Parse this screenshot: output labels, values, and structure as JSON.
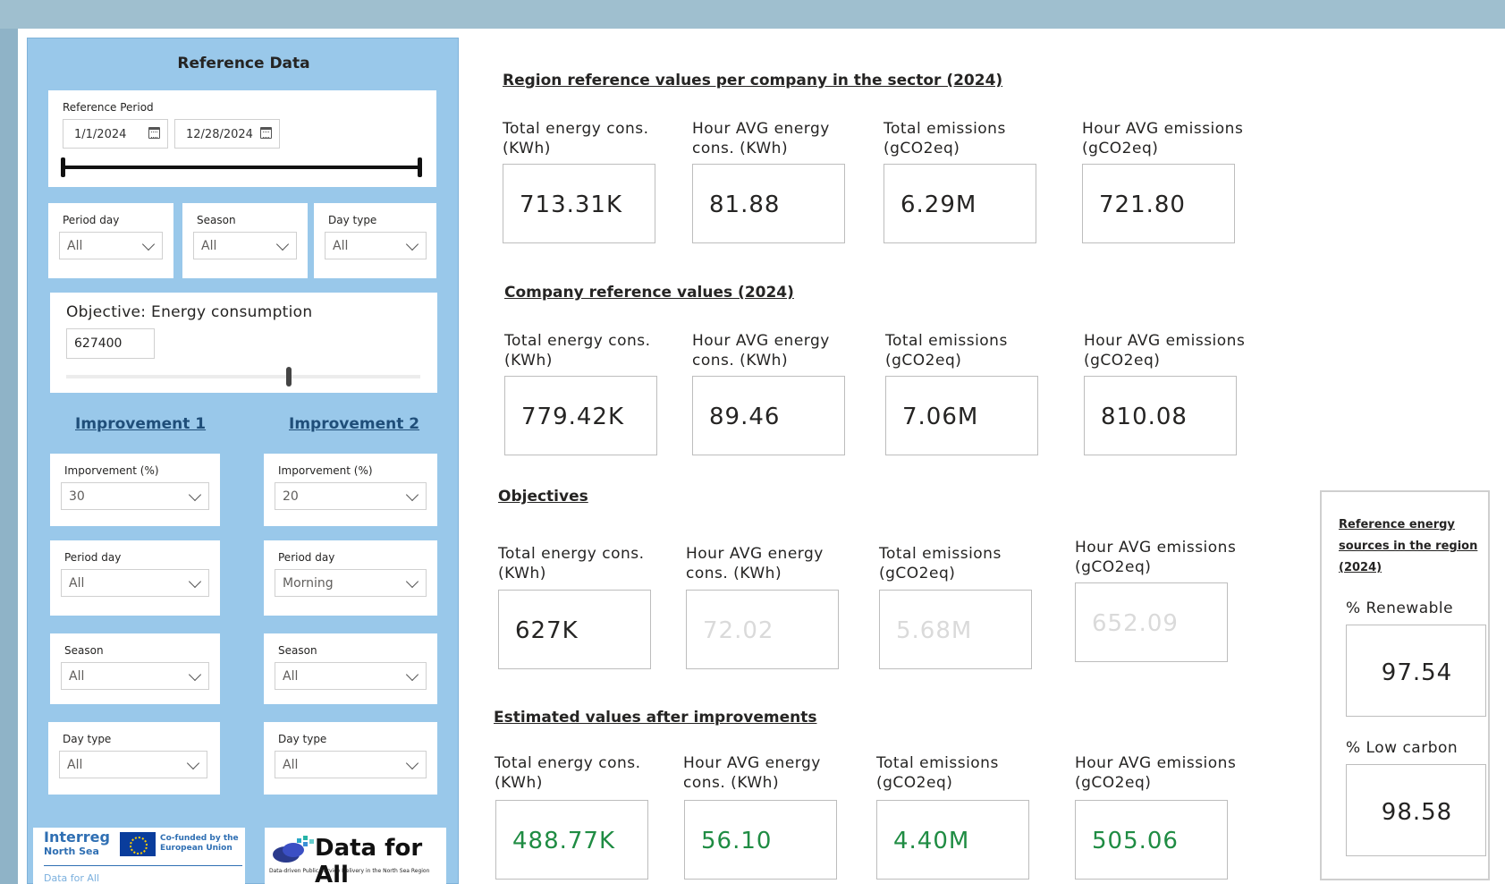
{
  "reference_panel": {
    "title": "Reference Data",
    "reference_period": {
      "label": "Reference Period",
      "start_date": "1/1/2024",
      "end_date": "12/28/2024"
    },
    "filters": [
      {
        "label": "Period day",
        "value": "All"
      },
      {
        "label": "Season",
        "value": "All"
      },
      {
        "label": "Day type",
        "value": "All"
      }
    ],
    "objective": {
      "title": "Objective: Energy consumption",
      "value": "627400"
    },
    "improvement1": {
      "heading": "Improvement 1",
      "improvement_label": "Imporvement (%)",
      "improvement_value": "30",
      "period_day_label": "Period day",
      "period_day_value": "All",
      "season_label": "Season",
      "season_value": "All",
      "day_type_label": "Day type",
      "day_type_value": "All"
    },
    "improvement2": {
      "heading": "Improvement 2",
      "improvement_label": "Imporvement (%)",
      "improvement_value": "20",
      "period_day_label": "Period day",
      "period_day_value": "Morning",
      "season_label": "Season",
      "season_value": "All",
      "day_type_label": "Day type",
      "day_type_value": "All"
    },
    "logos": {
      "interreg": "Interreg",
      "north_sea": "North Sea",
      "cofunded": "Co-funded by the European Union",
      "data_for_all_small": "Data for All",
      "data_for_all": "Data for All",
      "data_for_all_sub": "Data-driven Public Service Delivery in the North Sea Region"
    }
  },
  "labels": {
    "total_energy": "Total energy cons. (KWh)",
    "hour_avg_energy": "Hour AVG energy cons. (KWh)",
    "total_emissions": "Total emissions (gCO2eq)",
    "hour_avg_emissions": "Hour AVG emissions (gCO2eq)"
  },
  "sections": {
    "region": {
      "title": "Region reference values per company in the sector (2024)",
      "values": [
        "713.31K",
        "81.88",
        "6.29M",
        "721.80"
      ]
    },
    "company": {
      "title": "Company reference values (2024)",
      "values": [
        "779.42K",
        "89.46",
        "7.06M",
        "810.08"
      ]
    },
    "objectives": {
      "title": "Objectives",
      "values": [
        "627K",
        "72.02",
        "5.68M",
        "652.09"
      ]
    },
    "estimated": {
      "title": "Estimated values after improvements",
      "values": [
        "488.77K",
        "56.10",
        "4.40M",
        "505.06"
      ]
    }
  },
  "reference_sources": {
    "title": "Reference energy sources in the region (2024)",
    "renewable_label": "% Renewable",
    "renewable_value": "97.54",
    "low_carbon_label": "% Low carbon",
    "low_carbon_value": "98.58"
  },
  "colors": {
    "panel_bg": "#99c8ea",
    "improvement_heading": "#1f4e79",
    "estimated_value": "#1f8c43",
    "muted_value": "#dadada"
  }
}
